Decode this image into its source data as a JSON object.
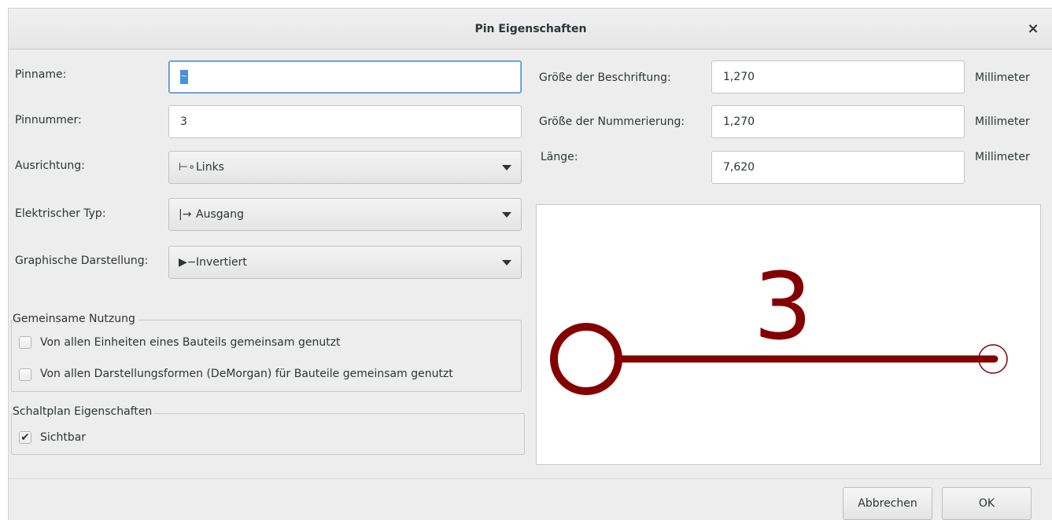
{
  "dialog": {
    "title": "Pin Eigenschaften",
    "close_label": "×"
  },
  "left": {
    "pin_name": {
      "label": "Pinname:",
      "value": "~"
    },
    "pin_number": {
      "label": "Pinnummer:",
      "value": "3"
    },
    "orientation": {
      "label": "Ausrichtung:",
      "glyph": "⊢∘",
      "value": "Links"
    },
    "electrical_type": {
      "label": "Elektrischer Typ:",
      "glyph": "|→",
      "value": "Ausgang"
    },
    "graphic_style": {
      "label": "Graphische Darstellung:",
      "glyph": "▶−",
      "value": "Invertiert"
    }
  },
  "shared": {
    "legend": "Gemeinsame Nutzung",
    "units_label": "Von allen Einheiten eines Bauteils gemeinsam genutzt",
    "units_checked": false,
    "demorgan_label": "Von allen Darstellungsformen (DeMorgan) für Bauteile gemeinsam genutzt",
    "demorgan_checked": false
  },
  "schematic": {
    "legend": "Schaltplan Eigenschaften",
    "visible_label": "Sichtbar",
    "visible_checked": true,
    "check_glyph": "✔"
  },
  "right": {
    "name_size": {
      "label": "Größe der Beschriftung:",
      "value": "1,270",
      "unit": "Millimeter"
    },
    "number_size": {
      "label": "Größe der Nummerierung:",
      "value": "1,270",
      "unit": "Millimeter"
    },
    "length": {
      "label": "Länge:",
      "value": "7,620",
      "unit": "Millimeter"
    }
  },
  "preview": {
    "pin_number_text": "3",
    "pin_color": "#840000"
  },
  "buttons": {
    "cancel": "Abbrechen",
    "ok": "OK"
  }
}
